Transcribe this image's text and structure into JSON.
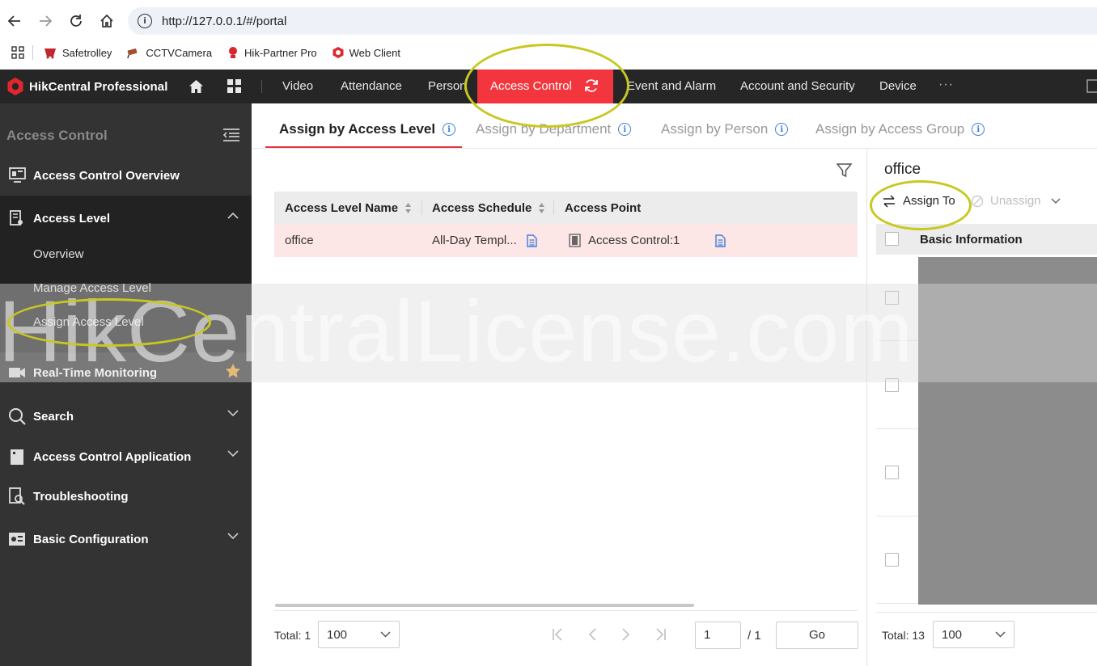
{
  "browser": {
    "url": "http://127.0.0.1/#/portal",
    "bookmarks": [
      "Safetrolley",
      "CCTVCamera",
      "Hik-Partner Pro",
      "Web Client"
    ]
  },
  "header": {
    "app_name": "HikCentral Professional",
    "tabs": [
      "Video",
      "Attendance",
      "Person",
      "Access Control",
      "Event and Alarm",
      "Account and Security",
      "Device"
    ],
    "active_tab": "Access Control",
    "more": "···",
    "accent_color": "#f3363d"
  },
  "sidebar": {
    "title": "Access Control",
    "items": [
      {
        "label": "Access Control Overview",
        "icon": "overview-icon"
      },
      {
        "label": "Access Level",
        "icon": "access-level-icon",
        "expanded": true
      },
      {
        "label": "Real-Time Monitoring",
        "icon": "camera-icon",
        "favorite": true
      },
      {
        "label": "Search",
        "icon": "search-icon"
      },
      {
        "label": "Access Control Application",
        "icon": "application-icon"
      },
      {
        "label": "Troubleshooting",
        "icon": "troubleshooting-icon"
      },
      {
        "label": "Basic Configuration",
        "icon": "configuration-icon"
      }
    ],
    "subitems": [
      "Overview",
      "Manage Access Level",
      "Assign Access Level"
    ]
  },
  "tabs": [
    "Assign by Access Level",
    "Assign by Department",
    "Assign by Person",
    "Assign by Access Group"
  ],
  "table": {
    "columns": [
      "Access Level Name",
      "Access Schedule",
      "Access Point"
    ],
    "rows": [
      {
        "name": "office",
        "schedule": "All-Day Templ...",
        "point": "Access Control:1"
      }
    ],
    "total_label": "Total: 1",
    "page_size": "100",
    "page": "1",
    "page_total": "/ 1",
    "go_label": "Go"
  },
  "right_panel": {
    "title": "office",
    "assign_label": "Assign To",
    "unassign_label": "Unassign",
    "column": "Basic Information",
    "total_label": "Total: 13",
    "page_size": "100"
  },
  "watermark": "HikCentralLicense.com"
}
